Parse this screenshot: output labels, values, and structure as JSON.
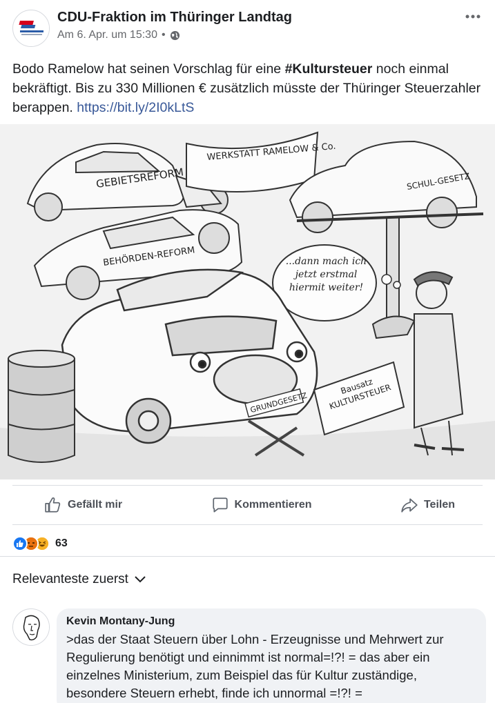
{
  "post": {
    "page_name": "CDU-Fraktion im Thüringer Landtag",
    "timestamp": "Am 6. Apr. um 15:30",
    "meta_separator": "•",
    "text_before": "Bodo Ramelow hat seinen Vorschlag für eine ",
    "hashtag": "#Kultursteuer",
    "text_after": " noch einmal bekräftigt. Bis zu 330 Millionen € zusätzlich müsste der Thüringer Steuerzahler berappen. ",
    "link": "https://bit.ly/2I0kLtS"
  },
  "cartoon": {
    "labels": {
      "gebietsreform": "GEBIETSREFORM",
      "werkstatt": "WERKSTATT RAMELOW & Co.",
      "schulgesetz": "SCHUL-GESETZ",
      "behoerdenreform": "BEHÖRDEN-REFORM",
      "speech": "...dann mach ich jetzt erstmal hiermit weiter!",
      "grundgesetz": "GRUNDGESETZ",
      "bausatz": "Bausatz KULTURSTEUER"
    }
  },
  "actions": {
    "like": "Gefällt mir",
    "comment": "Kommentieren",
    "share": "Teilen"
  },
  "reactions": {
    "count": "63",
    "types": [
      "like",
      "angry",
      "haha"
    ]
  },
  "sort": {
    "label": "Relevanteste zuerst"
  },
  "comment": {
    "author": "Kevin Montany-Jung",
    "text": ">das der Staat Steuern über Lohn - Erzeugnisse und Mehrwert zur Regulierung benötigt und einnimmt ist normal=!?! = das aber ein einzelnes Ministerium, zum Beispiel das für Kultur zuständige, besondere Steuern erhebt, finde ich unnormal =!?! ="
  },
  "colors": {
    "link": "#385898",
    "meta": "#65676b",
    "like_blue": "#1877f2",
    "cdu_red": "#d6001c",
    "cdu_blue": "#2a5ca8"
  }
}
